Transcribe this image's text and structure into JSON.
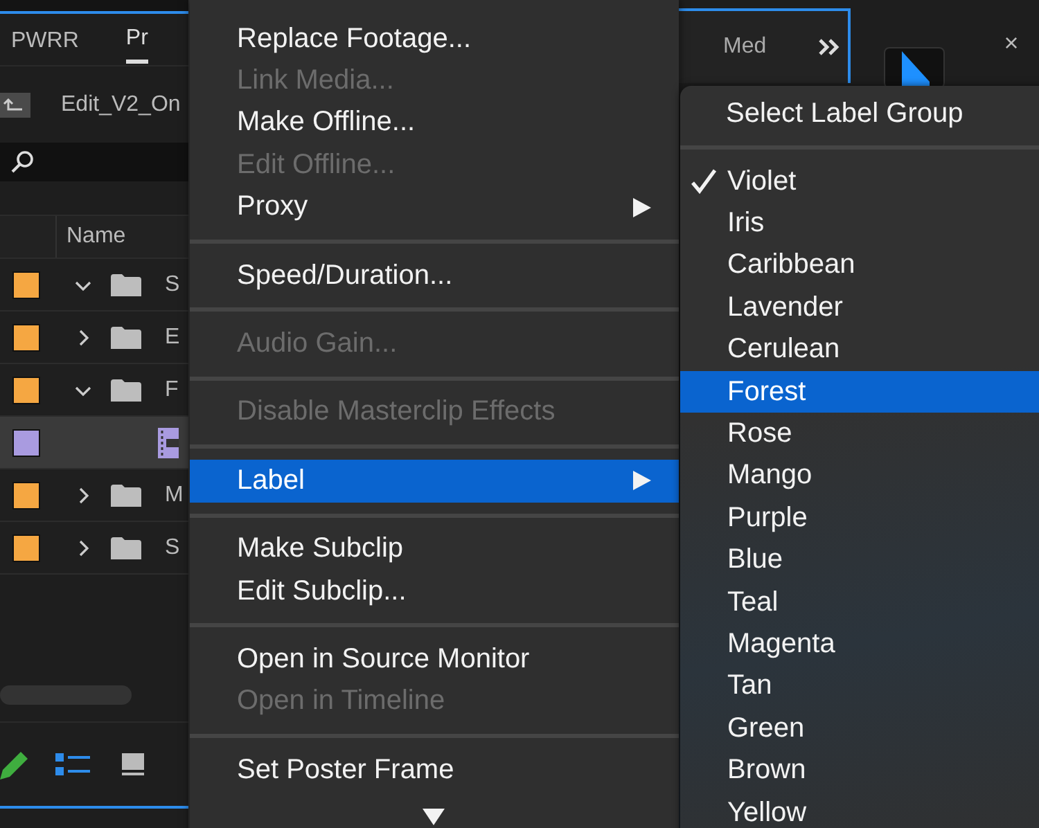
{
  "panel": {
    "tabs": [
      {
        "label": "PWRR",
        "selected": false
      },
      {
        "label": "Pr",
        "selected": true
      }
    ],
    "bin_path": "Edit_V2_On",
    "column": "Name",
    "rows": [
      {
        "kind": "folder",
        "color": "#f5a742",
        "expanded": true,
        "name": "S",
        "selected": false
      },
      {
        "kind": "folder",
        "color": "#f5a742",
        "expanded": false,
        "name": "E",
        "selected": false
      },
      {
        "kind": "folder",
        "color": "#f5a742",
        "expanded": true,
        "name": "F",
        "selected": false
      },
      {
        "kind": "clip",
        "color": "#a99be0",
        "selected": true
      },
      {
        "kind": "folder",
        "color": "#f5a742",
        "expanded": false,
        "name": "M",
        "selected": false
      },
      {
        "kind": "folder",
        "color": "#f5a742",
        "expanded": false,
        "name": "S",
        "selected": false
      }
    ],
    "views": [
      {
        "kind": "list",
        "selected": true
      },
      {
        "kind": "icon",
        "selected": false
      }
    ]
  },
  "right_panel": {
    "tab": "Med",
    "close": "×"
  },
  "menu": {
    "items": [
      {
        "kind": "item",
        "label": "Replace Footage...",
        "disabled": false,
        "submenu": false,
        "selected": false
      },
      {
        "kind": "item",
        "label": "Link Media...",
        "disabled": true,
        "submenu": false,
        "selected": false
      },
      {
        "kind": "item",
        "label": "Make Offline...",
        "disabled": false,
        "submenu": false,
        "selected": false
      },
      {
        "kind": "item",
        "label": "Edit Offline...",
        "disabled": true,
        "submenu": false,
        "selected": false
      },
      {
        "kind": "item",
        "label": "Proxy",
        "disabled": false,
        "submenu": true,
        "selected": false
      },
      {
        "kind": "separator"
      },
      {
        "kind": "item",
        "label": "Speed/Duration...",
        "disabled": false,
        "submenu": false,
        "selected": false
      },
      {
        "kind": "separator"
      },
      {
        "kind": "item",
        "label": "Audio Gain...",
        "disabled": true,
        "submenu": false,
        "selected": false
      },
      {
        "kind": "separator"
      },
      {
        "kind": "item",
        "label": "Disable Masterclip Effects",
        "disabled": true,
        "submenu": false,
        "selected": false
      },
      {
        "kind": "separator"
      },
      {
        "kind": "item",
        "label": "Label",
        "disabled": false,
        "submenu": true,
        "selected": true
      },
      {
        "kind": "separator"
      },
      {
        "kind": "item",
        "label": "Make Subclip",
        "disabled": false,
        "submenu": false,
        "selected": false
      },
      {
        "kind": "item",
        "label": "Edit Subclip...",
        "disabled": false,
        "submenu": false,
        "selected": false
      },
      {
        "kind": "separator"
      },
      {
        "kind": "item",
        "label": "Open in Source Monitor",
        "disabled": false,
        "submenu": false,
        "selected": false
      },
      {
        "kind": "item",
        "label": "Open in Timeline",
        "disabled": true,
        "submenu": false,
        "selected": false
      },
      {
        "kind": "separator"
      },
      {
        "kind": "item",
        "label": "Set Poster Frame",
        "disabled": false,
        "submenu": false,
        "selected": false
      }
    ]
  },
  "submenu": {
    "title": "Select Label Group",
    "items": [
      {
        "label": "Violet",
        "checked": true,
        "selected": false
      },
      {
        "label": "Iris",
        "checked": false,
        "selected": false
      },
      {
        "label": "Caribbean",
        "checked": false,
        "selected": false
      },
      {
        "label": "Lavender",
        "checked": false,
        "selected": false
      },
      {
        "label": "Cerulean",
        "checked": false,
        "selected": false
      },
      {
        "label": "Forest",
        "checked": false,
        "selected": true
      },
      {
        "label": "Rose",
        "checked": false,
        "selected": false
      },
      {
        "label": "Mango",
        "checked": false,
        "selected": false
      },
      {
        "label": "Purple",
        "checked": false,
        "selected": false
      },
      {
        "label": "Blue",
        "checked": false,
        "selected": false
      },
      {
        "label": "Teal",
        "checked": false,
        "selected": false
      },
      {
        "label": "Magenta",
        "checked": false,
        "selected": false
      },
      {
        "label": "Tan",
        "checked": false,
        "selected": false
      },
      {
        "label": "Green",
        "checked": false,
        "selected": false
      },
      {
        "label": "Brown",
        "checked": false,
        "selected": false
      },
      {
        "label": "Yellow",
        "checked": false,
        "selected": false
      }
    ]
  }
}
